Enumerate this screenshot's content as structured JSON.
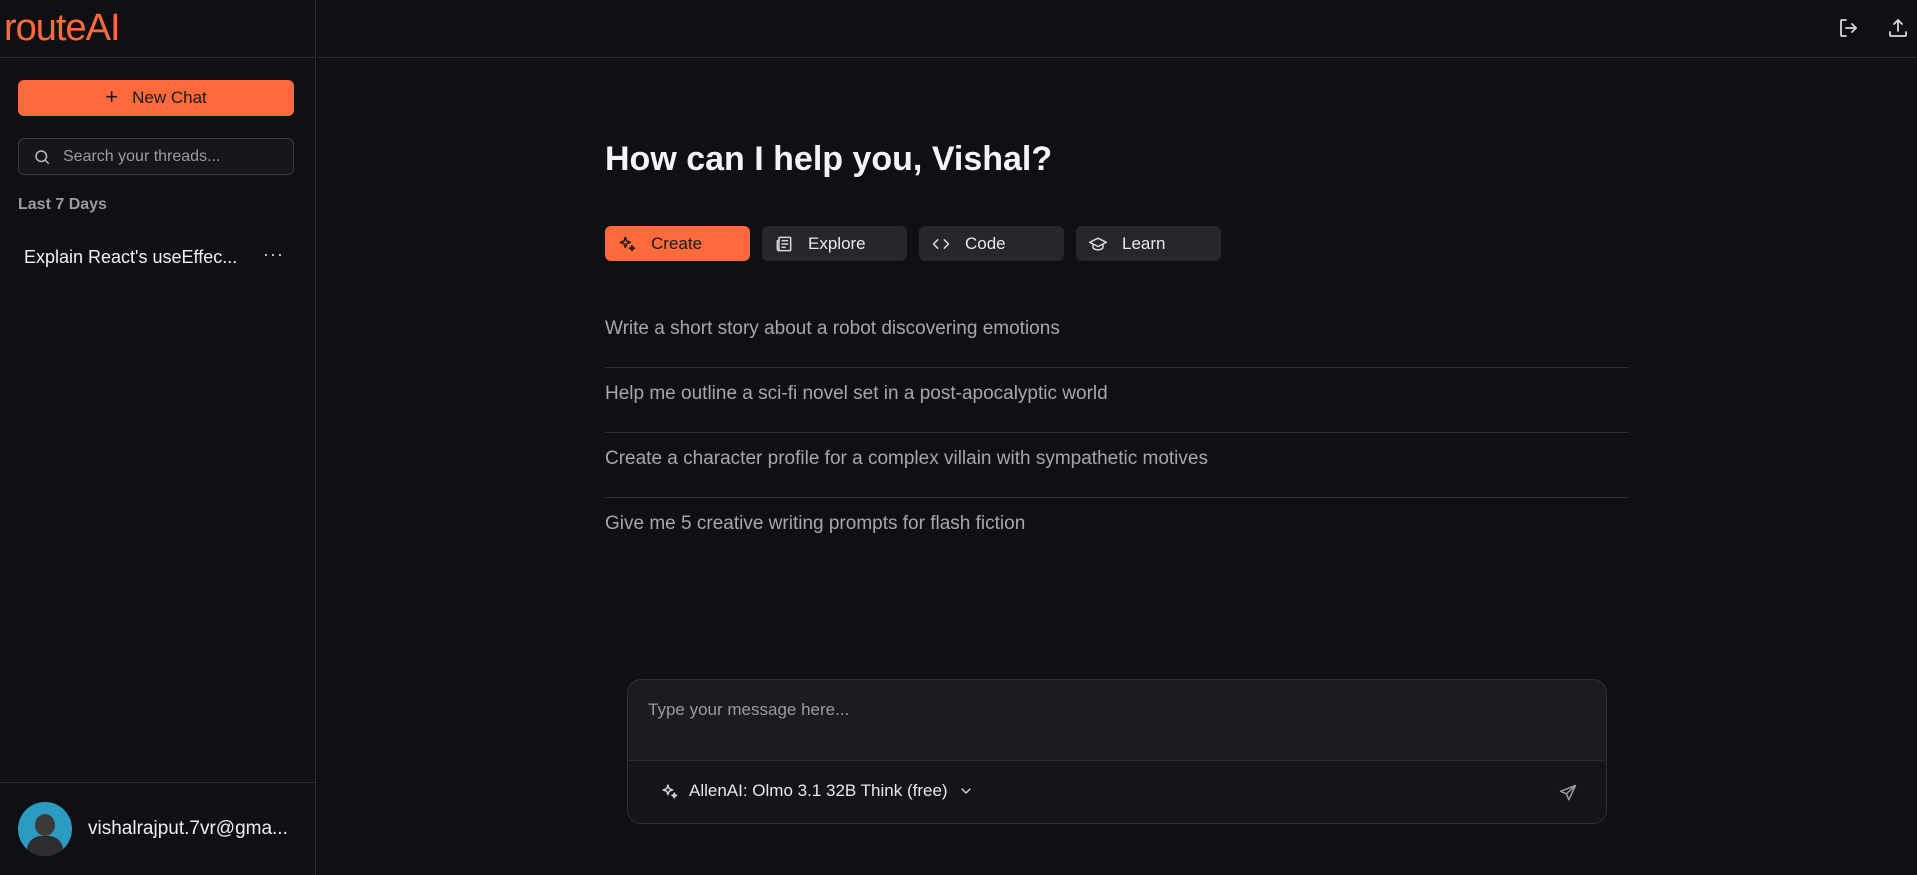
{
  "app": {
    "logo": "routeAI"
  },
  "sidebar": {
    "new_chat_label": "New Chat",
    "search_placeholder": "Search your threads...",
    "section_label": "Last 7 Days",
    "threads": [
      {
        "title": "Explain React's useEffec...",
        "more": "···"
      }
    ],
    "user_email": "vishalrajput.7vr@gma..."
  },
  "topbar": {
    "icons": [
      "logout-icon",
      "share-icon"
    ]
  },
  "main": {
    "greeting": "How can I help you, Vishal?",
    "tabs": [
      {
        "label": "Create",
        "icon": "sparkles-icon",
        "active": true
      },
      {
        "label": "Explore",
        "icon": "newspaper-icon",
        "active": false
      },
      {
        "label": "Code",
        "icon": "code-icon",
        "active": false
      },
      {
        "label": "Learn",
        "icon": "graduation-cap-icon",
        "active": false
      }
    ],
    "suggestions": [
      "Write a short story about a robot discovering emotions",
      "Help me outline a sci-fi novel set in a post-apocalyptic world",
      "Create a character profile for a complex villain with sympathetic motives",
      "Give me 5 creative writing prompts for flash fiction"
    ]
  },
  "composer": {
    "placeholder": "Type your message here...",
    "model": "AllenAI: Olmo 3.1 32B Think (free)"
  },
  "colors": {
    "accent": "#ff6a3d",
    "background": "#0f1013"
  }
}
